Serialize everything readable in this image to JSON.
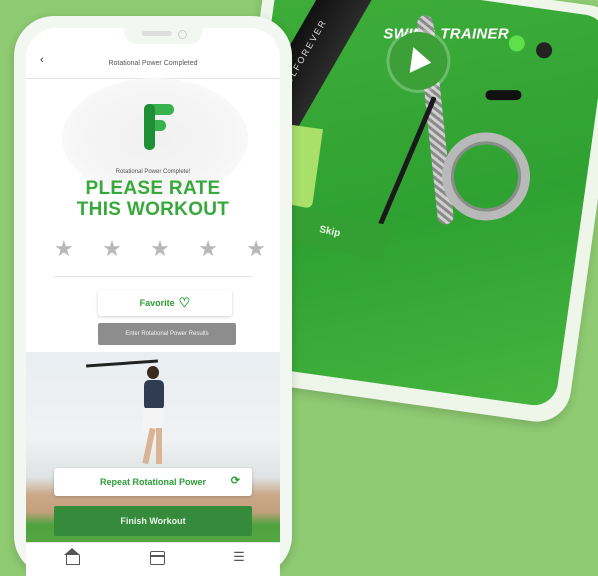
{
  "tablet": {
    "title": "SWING TRAINER",
    "brand_text": "GOLFOREVER",
    "skip_label": "Skip"
  },
  "phone": {
    "header": {
      "back_icon": "‹",
      "title": "Rotational Power Completed"
    },
    "subtitle": "Rotational Power Complete!",
    "rate_title_line1": "PLEASE RATE",
    "rate_title_line2": "THIS WORKOUT",
    "stars": [
      "★",
      "★",
      "★",
      "★",
      "★"
    ],
    "favorite_label": "Favorite",
    "heart_icon": "♡",
    "enter_results_label": "Enter Rotational Power Results",
    "repeat_label": "Repeat Rotational Power",
    "repeat_icon": "⟳",
    "finish_label": "Finish Workout",
    "tabbar": {
      "menu_icon": "☰"
    }
  },
  "colors": {
    "background": "#8fcb72",
    "brand_green": "#37a93a",
    "finish_button": "#358a3b",
    "star_inactive": "#b8b8b8"
  }
}
